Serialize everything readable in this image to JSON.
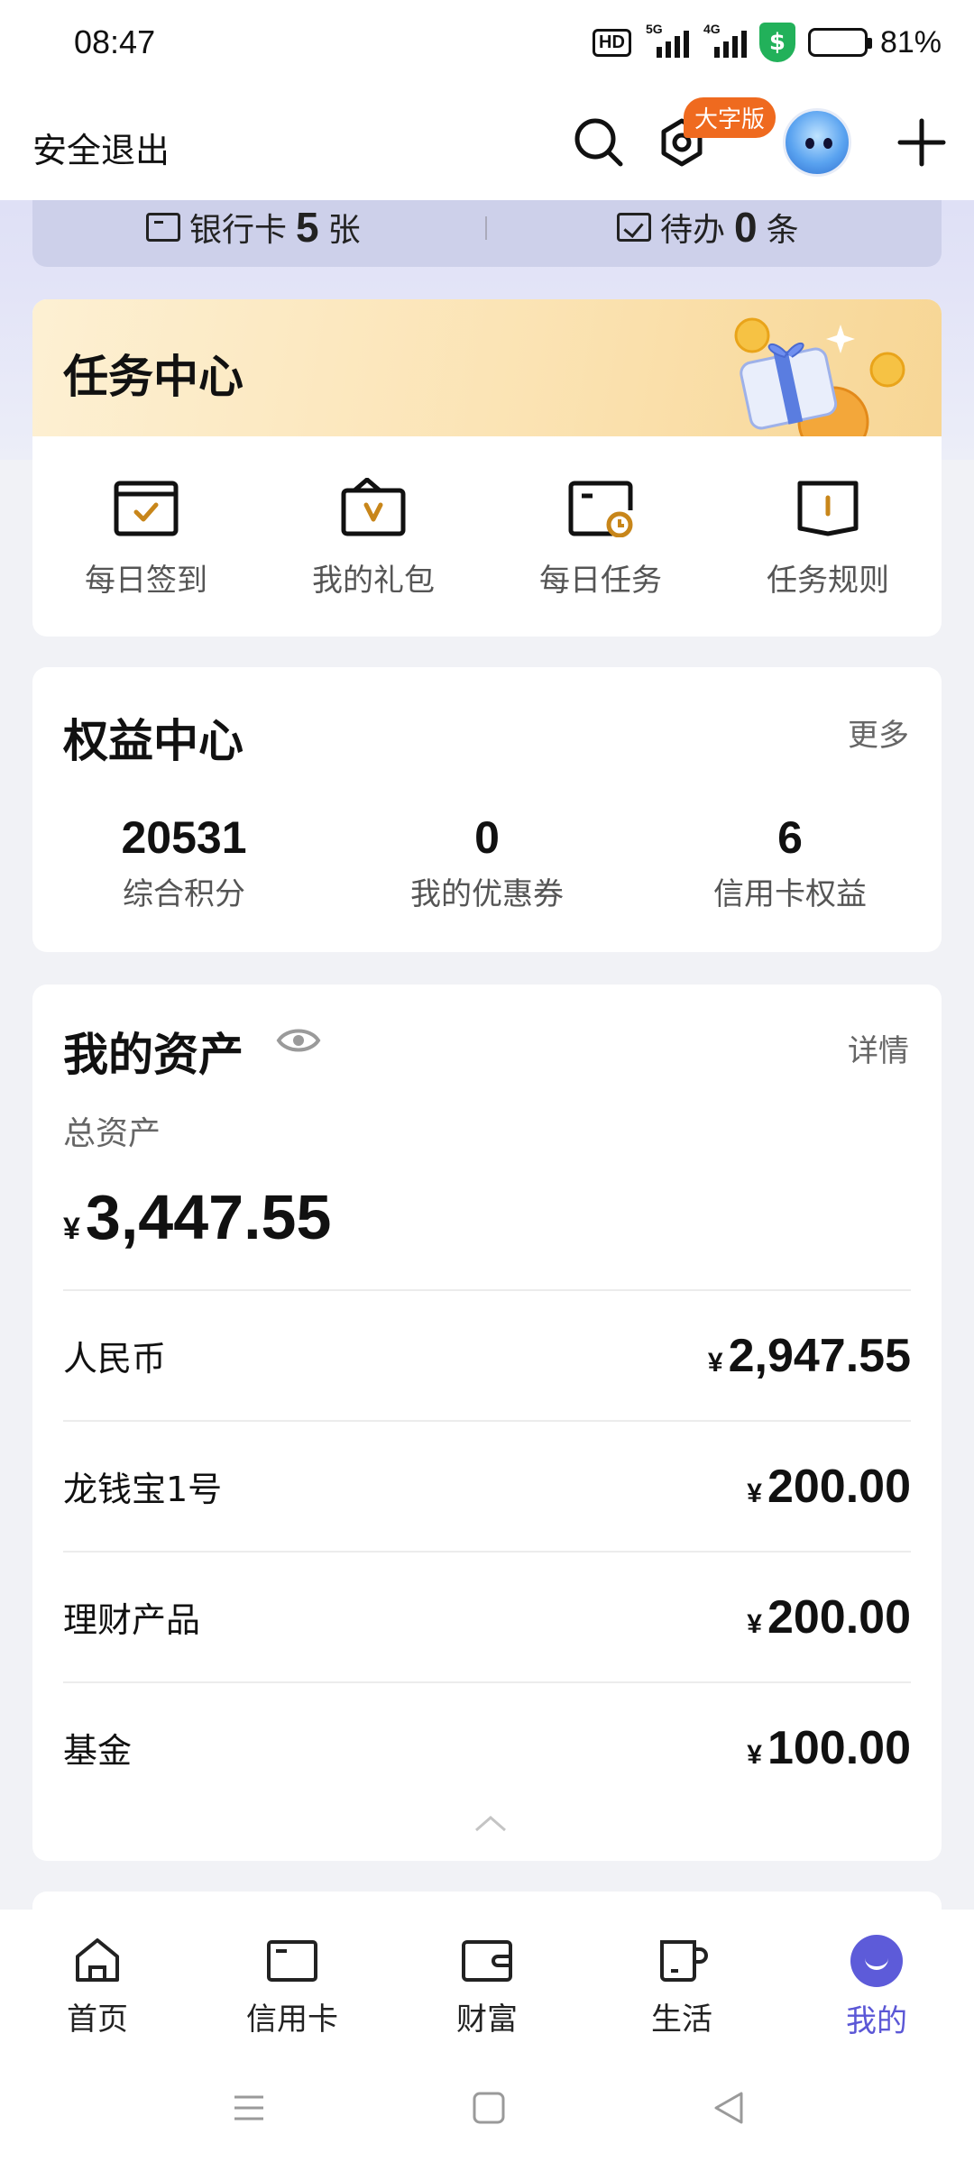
{
  "status_bar": {
    "time": "08:47",
    "hd": "HD",
    "net1": "5G",
    "net2": "4G",
    "battery_pct": "81%",
    "battery_level": 0.81
  },
  "header": {
    "logout_label": "安全退出",
    "large_font_badge": "大字版",
    "icons": [
      "search-icon",
      "settings-icon",
      "avatar",
      "plus-icon"
    ]
  },
  "summary": {
    "bank_card_label": "银行卡",
    "bank_card_count": "5",
    "bank_card_unit": "张",
    "todo_label": "待办",
    "todo_count": "0",
    "todo_unit": "条"
  },
  "task_center": {
    "title": "任务中心",
    "items": [
      {
        "label": "每日签到",
        "icon": "calendar-check-icon"
      },
      {
        "label": "我的礼包",
        "icon": "gift-bag-icon"
      },
      {
        "label": "每日任务",
        "icon": "task-clock-icon"
      },
      {
        "label": "任务规则",
        "icon": "rules-book-icon"
      }
    ]
  },
  "rights_center": {
    "title": "权益中心",
    "more": "更多",
    "items": [
      {
        "value": "20531",
        "label": "综合积分"
      },
      {
        "value": "0",
        "label": "我的优惠券"
      },
      {
        "value": "6",
        "label": "信用卡权益"
      }
    ]
  },
  "assets": {
    "title": "我的资产",
    "detail": "详情",
    "total_label": "总资产",
    "currency_symbol": "¥",
    "total_value": "3,447.55",
    "rows": [
      {
        "name": "人民币",
        "value": "2,947.55"
      },
      {
        "name": "龙钱宝1号",
        "value": "200.00"
      },
      {
        "name": "理财产品",
        "value": "200.00"
      },
      {
        "name": "基金",
        "value": "100.00"
      }
    ]
  },
  "bottom_nav": {
    "items": [
      {
        "label": "首页",
        "icon": "home-icon"
      },
      {
        "label": "信用卡",
        "icon": "credit-card-icon"
      },
      {
        "label": "财富",
        "icon": "wallet-icon"
      },
      {
        "label": "生活",
        "icon": "cup-icon"
      },
      {
        "label": "我的",
        "icon": "me-icon"
      }
    ],
    "active": "我的",
    "active_color": "#5b57d6"
  },
  "colors": {
    "badge_orange": "#ef6a1f",
    "accent_purple": "#5b57d6",
    "task_gold": "#c8861a"
  }
}
